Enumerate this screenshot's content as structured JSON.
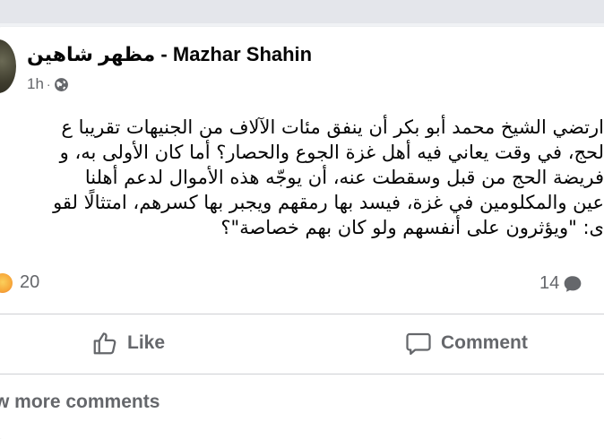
{
  "post": {
    "author": "مظهر شاهين - Mazhar Shahin",
    "time": "1h",
    "separator": "·",
    "privacy_icon": "globe-icon",
    "body_lines": [
      "ارتضي الشيخ محمد أبو بكر أن ينفق مئات الآلاف من الجنيهات تقريبا ع",
      "لحج، في وقت يعاني فيه أهل غزة الجوع والحصار؟ أما كان الأولى به، و",
      "فريضة الحج من قبل وسقطت عنه، أن يوجّه هذه الأموال لدعم أهلنا",
      "عين والمكلومين في غزة، فيسد بها رمقهم ويجبر بها كسرهم، امتثالًا لقو",
      "ى: \"ويؤثرون على أنفسهم ولو كان بهم خصاصة\"؟"
    ],
    "reactions_count": "20",
    "comments_count": "14"
  },
  "actions": {
    "like_label": "Like",
    "comment_label": "Comment"
  },
  "footer": {
    "more_comments": "w more comments"
  }
}
